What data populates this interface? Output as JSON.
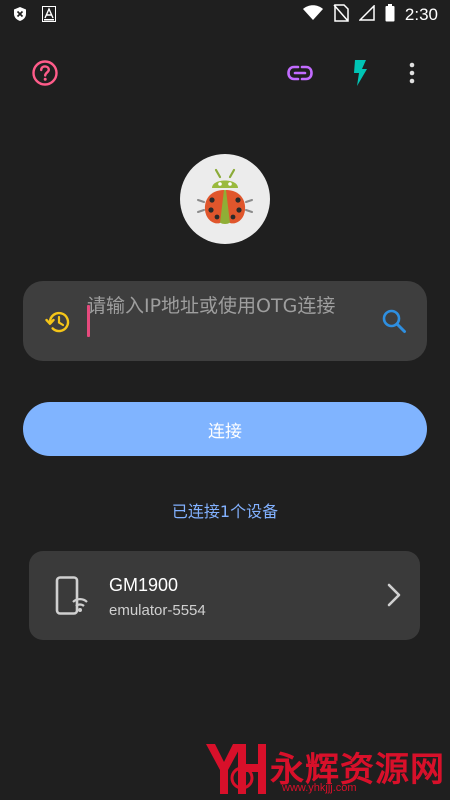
{
  "status_bar": {
    "time": "2:30",
    "icons": [
      "close-badge-icon",
      "font-a-icon",
      "wifi-icon",
      "no-sim-icon",
      "signal-icon",
      "battery-icon"
    ]
  },
  "toolbar": {
    "icons": [
      "help-icon",
      "link-icon",
      "flash-icon",
      "more-vert-icon"
    ],
    "colors": {
      "help": "#ff5c8a",
      "link": "#c26bff",
      "flash": "#00c4b4",
      "more": "#e0e0e0"
    }
  },
  "logo": {
    "name": "bug-logo"
  },
  "search": {
    "placeholder": "请输入IP地址或使用OTG连接",
    "history_icon": "history-icon",
    "search_icon": "search-icon"
  },
  "connect_button": {
    "label": "连接",
    "color": "#80b4ff"
  },
  "connected_status": "已连接1个设备",
  "devices": [
    {
      "name": "GM1900",
      "serial": "emulator-5554",
      "icon": "phone-wifi-icon"
    }
  ],
  "watermark": {
    "text": "永辉资源网",
    "url": "www.yhkjjj.com"
  }
}
